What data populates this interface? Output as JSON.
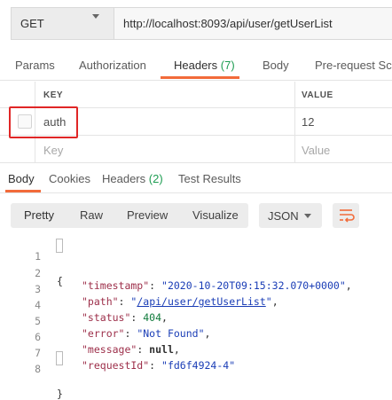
{
  "request": {
    "method": "GET",
    "url": "http://localhost:8093/api/user/getUserList"
  },
  "request_tabs": {
    "params": "Params",
    "authorization": "Authorization",
    "headers": "Headers",
    "headers_count": "(7)",
    "body": "Body",
    "pre_request": "Pre-request Scri"
  },
  "headers_table": {
    "col_key": "KEY",
    "col_value": "VALUE",
    "rows": [
      {
        "key": "auth",
        "value": "12"
      }
    ],
    "placeholder_key": "Key",
    "placeholder_value": "Value"
  },
  "response_tabs": {
    "body": "Body",
    "cookies": "Cookies",
    "headers": "Headers",
    "headers_count": "(2)",
    "test_results": "Test Results"
  },
  "format_toolbar": {
    "pretty": "Pretty",
    "raw": "Raw",
    "preview": "Preview",
    "visualize": "Visualize",
    "language": "JSON"
  },
  "response_body": {
    "line_numbers": [
      "1",
      "2",
      "3",
      "4",
      "5",
      "6",
      "7",
      "8"
    ],
    "open_brace": "{",
    "close_brace": "}",
    "timestamp_key": "\"timestamp\"",
    "timestamp_value": "\"2020-10-20T09:15:32.070+0000\"",
    "path_key": "\"path\"",
    "path_value": "/api/user/getUserList",
    "status_key": "\"status\"",
    "status_value": "404",
    "error_key": "\"error\"",
    "error_value": "\"Not Found\"",
    "message_key": "\"message\"",
    "message_value": "null",
    "requestid_key": "\"requestId\"",
    "requestid_value": "\"fd6f4924-4\""
  },
  "colors": {
    "accent": "#f26b3a",
    "count": "#1e9d52",
    "highlight": "#e02626"
  }
}
